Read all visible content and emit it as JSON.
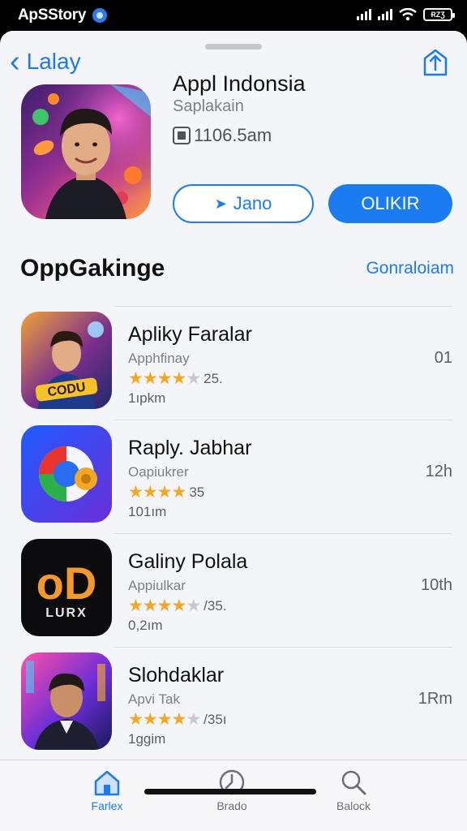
{
  "status_bar": {
    "left_text": "ApSStory",
    "battery_text": "ɌΖƷ"
  },
  "header": {
    "back_label": "Lalay"
  },
  "app": {
    "title": "Appl Indonsia",
    "subtitle": "Saplakain",
    "size": "1106.5am",
    "secondary_button": "Jano",
    "primary_button": "OLIKIR"
  },
  "section": {
    "title": "OppGakinge",
    "link": "Gonraloiam"
  },
  "apps": [
    {
      "name": "Apliky Faralar",
      "category": "Apphfinay",
      "stars": 4,
      "rating": "25.",
      "size": "1ıpkm",
      "right": "01"
    },
    {
      "name": "Raply. Jabhar",
      "category": "Oapiukrer",
      "stars": 4,
      "rating": "35",
      "size": "101ım",
      "right": "12h"
    },
    {
      "name": "Galiny Polala",
      "category": "Appiulkar",
      "stars": 4,
      "rating": "/35.",
      "size": "0,2ım",
      "right": "10th"
    },
    {
      "name": "Slohdaklar",
      "category": "Apvi Tak",
      "stars": 4,
      "rating": "/35ı",
      "size": "1ggim",
      "right": "1Rm"
    }
  ],
  "app_icon_texts": {
    "row1": "CODU",
    "row3_logo": "oD",
    "row3_word": "LURX"
  },
  "tabs": [
    {
      "label": "Farlex",
      "icon": "home-icon",
      "active": true
    },
    {
      "label": "Brado",
      "icon": "clock-icon",
      "active": false
    },
    {
      "label": "Balock",
      "icon": "search-icon",
      "active": false
    }
  ],
  "colors": {
    "accent": "#1a7cf0",
    "star": "#f5a623",
    "background": "#f4f5f8"
  }
}
